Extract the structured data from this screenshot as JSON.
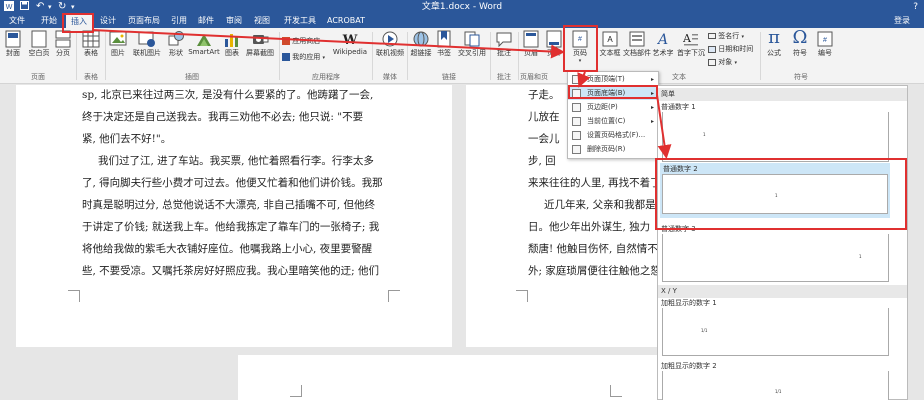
{
  "titlebar": {
    "title": "文章1.docx - Word",
    "help": "?"
  },
  "tabs": {
    "items": [
      "文件",
      "开始",
      "插入",
      "设计",
      "页面布局",
      "引用",
      "邮件",
      "审阅",
      "视图",
      "开发工具",
      "ACROBAT"
    ],
    "login": "登录"
  },
  "ribbon": {
    "buttons": {
      "cover": "封面",
      "blank": "空白页",
      "pagebreak": "分页",
      "table": "表格",
      "picture": "图片",
      "online_picture": "联机图片",
      "shapes": "形状",
      "smartart": "SmartArt",
      "chart": "图表",
      "screenshot": "屏幕截图",
      "app_store": "应用商店",
      "my_apps": "我的应用",
      "wikipedia": "Wikipedia",
      "online_video": "联机视频",
      "hyperlink": "超链接",
      "bookmark": "书签",
      "crossref": "交叉引用",
      "comment": "批注",
      "header": "页眉",
      "footer": "页脚",
      "page_number": "页码",
      "textbox": "文本框",
      "quickparts": "文档部件",
      "wordart": "艺术字",
      "dropcap": "首字下沉",
      "signature": "签名行",
      "datetime": "日期和时间",
      "object": "对象",
      "equation": "公式",
      "symbol": "符号",
      "number": "编号"
    },
    "groups": {
      "pages": "页面",
      "tables": "表格",
      "illustrations": "插图",
      "apps": "应用程序",
      "media": "媒体",
      "links": "链接",
      "comments": "批注",
      "header_footer": "页眉和页",
      "text": "文本",
      "symbols": "符号"
    }
  },
  "document": {
    "left_lines": [
      "sp, 北京已来往过两三次, 是没有什么要紧的了。他踌躇了一会,",
      "终于决定还是自己送我去。我再三劝他不必去; 他只说: \"不要",
      "紧, 他们去不好!\"。",
      "我们过了江, 进了车站。我买票, 他忙着照看行李。行李太多",
      "了, 得向脚夫行些小费才可过去。他便又忙着和他们讲价钱。我那",
      "时真是聪明过分, 总觉他说话不大漂亮, 非自己插嘴不可, 但他终",
      "于讲定了价钱; 就送我上车。他给我拣定了靠车门的一张椅子; 我",
      "将他给我做的紫毛大衣铺好座位。他嘱我路上小心, 夜里要警醒",
      "些, 不要受凉。又嘱托茶房好好照应我。我心里暗笑他的迂; 他们"
    ],
    "right_lines": [
      "子走。",
      "儿放在",
      "一会儿",
      "步, 回",
      "来来往往的人里, 再找不着了",
      "近几年来, 父亲和我都是",
      "日。他少年出外谋生, 独力",
      "颓唐! 他触目伤怀, 自然情不",
      "外; 家庭琐屑便往往触他之怒"
    ]
  },
  "menu": {
    "items": [
      {
        "label": "页面顶端(T)",
        "arrow": "▸"
      },
      {
        "label": "页面底端(B)",
        "arrow": "▸"
      },
      {
        "label": "页边距(P)",
        "arrow": "▸"
      },
      {
        "label": "当前位置(C)",
        "arrow": "▸"
      },
      {
        "label": "设置页码格式(F)...",
        "arrow": ""
      },
      {
        "label": "删除页码(R)",
        "arrow": ""
      }
    ]
  },
  "gallery": {
    "section_simple": "简单",
    "items": [
      {
        "label": "普通数字 1",
        "number": "1"
      },
      {
        "label": "普通数字 2",
        "number": "1"
      },
      {
        "label": "普通数字 3",
        "number": "1"
      }
    ],
    "section_xy": "X / Y",
    "bold_items": [
      {
        "label": "加粗显示的数字 1",
        "number": "1/1"
      },
      {
        "label": "加粗显示的数字 2",
        "number": "1/1"
      }
    ]
  },
  "colors": {
    "accent": "#2b579a",
    "annotation": "#e03030",
    "highlight": "#cde6f7"
  }
}
